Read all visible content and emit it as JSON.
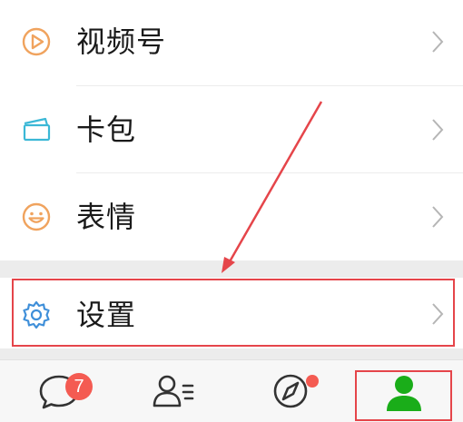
{
  "menu": {
    "channels_label": "视频号",
    "card_label": "卡包",
    "stickers_label": "表情",
    "settings_label": "设置"
  },
  "tabbar": {
    "chats_badge": "7"
  },
  "colors": {
    "channels_icon": "#f0a35e",
    "card_icon": "#3bb8d6",
    "sticker_icon": "#f0a35e",
    "settings_icon": "#3f8fd9",
    "annotation_red": "#e5454a",
    "active_tab": "#1aad19",
    "badge": "#f45b52"
  },
  "icons": {
    "channels": "play-circle-icon",
    "card": "card-wallet-icon",
    "stickers": "smiley-icon",
    "settings": "gear-icon",
    "chevron": "chevron-right-icon",
    "chats": "chat-bubble-icon",
    "contacts": "contacts-icon",
    "discover": "compass-icon",
    "me": "person-icon"
  }
}
